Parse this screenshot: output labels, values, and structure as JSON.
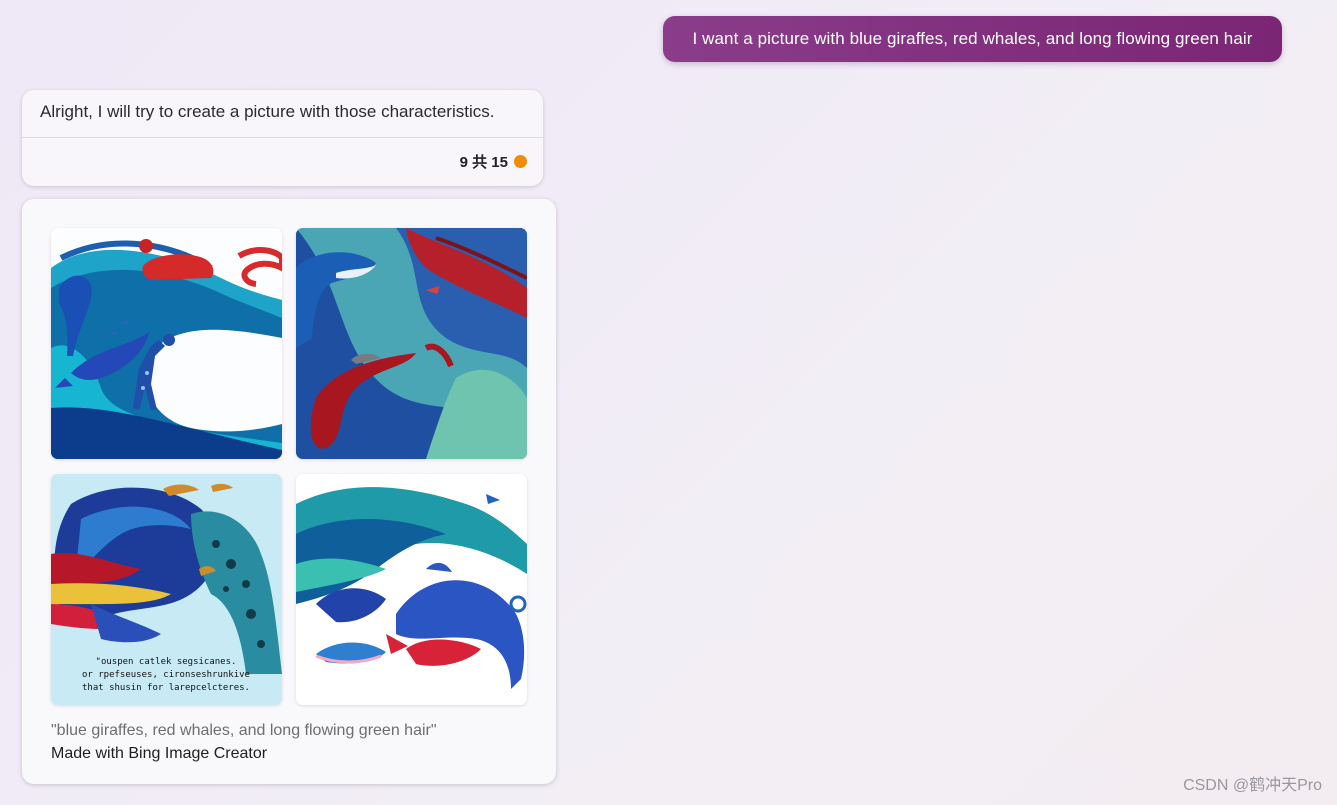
{
  "conversation": {
    "user_message": "I want a picture with blue giraffes, red whales, and long flowing green hair",
    "bot_message": "Alright, I will try to create a picture with those characteristics.",
    "turn_counter": "9 共 15",
    "turn_indicator_color": "#f08c00"
  },
  "image_result": {
    "images": [
      {
        "icon": "generated-image-1"
      },
      {
        "icon": "generated-image-2"
      },
      {
        "icon": "generated-image-3",
        "overlay_text": "\"ouspen catlek segsicanes.\nor rpefseuses, cironseshrunkive\nthat shusin for larepcelcteres."
      },
      {
        "icon": "generated-image-4"
      }
    ],
    "caption": "\"blue giraffes, red whales, and long flowing green hair\"",
    "credit": "Made with Bing Image Creator"
  },
  "watermark": "CSDN @鹤冲天Pro",
  "colors": {
    "user_bubble": "#812f7e",
    "card_background": "#f8f6fa",
    "page_background": "#efe8f6"
  }
}
